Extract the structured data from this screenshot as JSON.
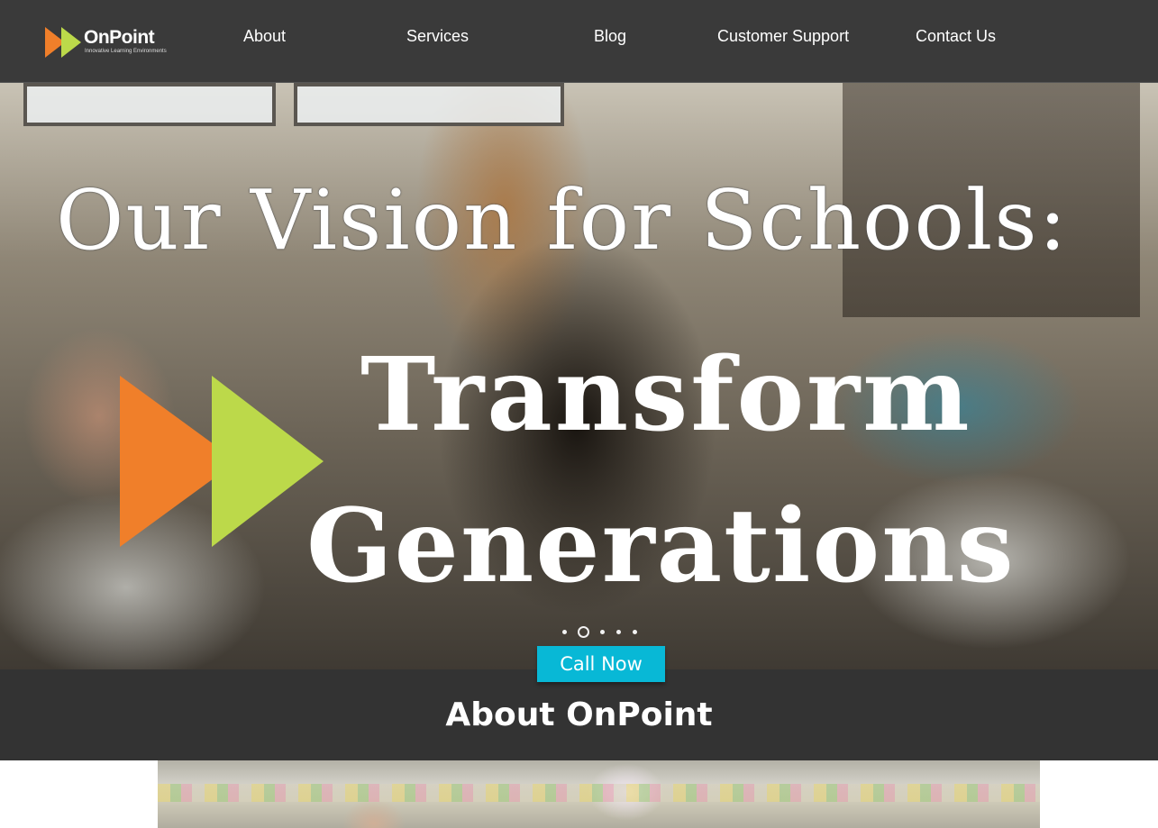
{
  "brand": {
    "name": "OnPoint",
    "tagline": "Innovative Learning Environments",
    "colors": {
      "orange": "#f07f2a",
      "green": "#bcd94a"
    }
  },
  "nav": {
    "items": [
      {
        "label": "About"
      },
      {
        "label": "Services"
      },
      {
        "label": "Blog"
      },
      {
        "label": "Customer Support"
      },
      {
        "label": "Contact Us"
      }
    ]
  },
  "hero": {
    "line1": "Our Vision for Schools:",
    "line2": "Transform",
    "line3": "Generations",
    "slides": {
      "count": 5,
      "active": 2
    },
    "cta_label": "Call Now",
    "cta_color": "#08b8d6"
  },
  "about": {
    "title": "About OnPoint"
  }
}
